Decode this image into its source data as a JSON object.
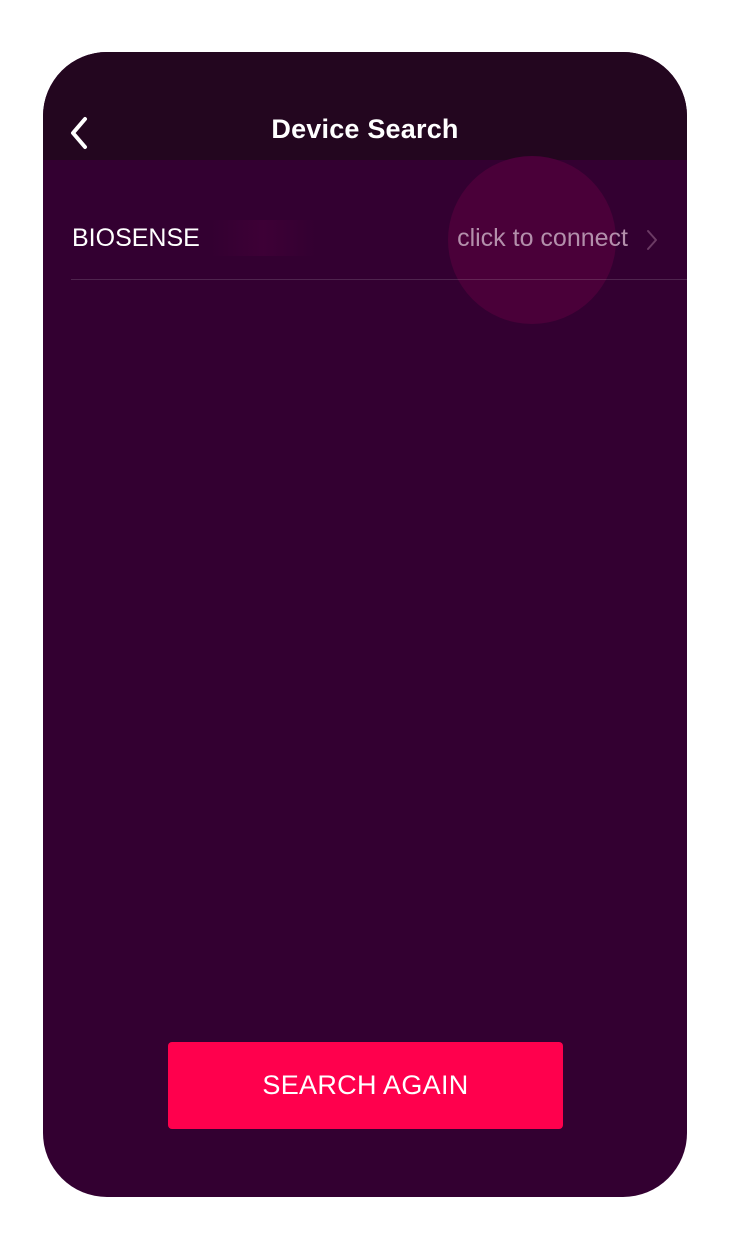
{
  "navbar": {
    "title": "Device Search",
    "back_icon": "chevron-left-icon"
  },
  "devices": [
    {
      "name": "BIOSENSE",
      "action_label": "click to connect",
      "action_icon": "chevron-right-icon"
    }
  ],
  "footer": {
    "search_again_label": "SEARCH AGAIN"
  },
  "colors": {
    "background": "#330031",
    "navbar": "#23061f",
    "accent": "#ff004d",
    "secondary_text": "#b38fab"
  }
}
